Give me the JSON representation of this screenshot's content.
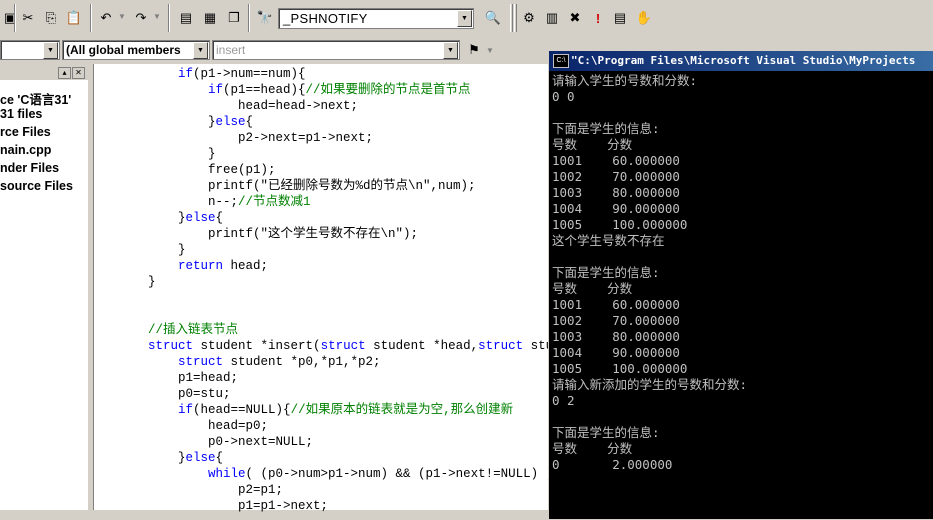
{
  "toolbar1": {
    "class_combo_value": "_PSHNOTIFY"
  },
  "toolbar2": {
    "combo_a": "",
    "combo_members": "(All global members",
    "combo_insert": "insert"
  },
  "workspace": {
    "tree": [
      "ce 'C语言31'",
      "31 files",
      "rce Files",
      "nain.cpp",
      "nder Files",
      "source Files"
    ]
  },
  "editor": {
    "lines": [
      [
        {
          "t": "        ",
          "c": ""
        },
        {
          "t": "if",
          "c": "kw"
        },
        {
          "t": "(p1->num==num){",
          "c": ""
        }
      ],
      [
        {
          "t": "            ",
          "c": ""
        },
        {
          "t": "if",
          "c": "kw"
        },
        {
          "t": "(p1==head){",
          "c": ""
        },
        {
          "t": "//如果要删除的节点是首节点",
          "c": "cm"
        }
      ],
      [
        {
          "t": "                head=head->next;",
          "c": ""
        }
      ],
      [
        {
          "t": "            }",
          "c": ""
        },
        {
          "t": "else",
          "c": "kw"
        },
        {
          "t": "{",
          "c": ""
        }
      ],
      [
        {
          "t": "                p2->next=p1->next;",
          "c": ""
        }
      ],
      [
        {
          "t": "            }",
          "c": ""
        }
      ],
      [
        {
          "t": "            free(p1);",
          "c": ""
        }
      ],
      [
        {
          "t": "            printf(\"已经删除号数为%d的节点\\n\",num);",
          "c": ""
        }
      ],
      [
        {
          "t": "            n--;",
          "c": ""
        },
        {
          "t": "//节点数减1",
          "c": "cm"
        }
      ],
      [
        {
          "t": "        }",
          "c": ""
        },
        {
          "t": "else",
          "c": "kw"
        },
        {
          "t": "{",
          "c": ""
        }
      ],
      [
        {
          "t": "            printf(\"这个学生号数不存在\\n\");",
          "c": ""
        }
      ],
      [
        {
          "t": "        }",
          "c": ""
        }
      ],
      [
        {
          "t": "        ",
          "c": ""
        },
        {
          "t": "return",
          "c": "kw"
        },
        {
          "t": " head;",
          "c": ""
        }
      ],
      [
        {
          "t": "    }",
          "c": ""
        }
      ],
      [
        {
          "t": "",
          "c": ""
        }
      ],
      [
        {
          "t": "",
          "c": ""
        }
      ],
      [
        {
          "t": "    ",
          "c": ""
        },
        {
          "t": "//插入链表节点",
          "c": "cm"
        }
      ],
      [
        {
          "t": "    ",
          "c": ""
        },
        {
          "t": "struct",
          "c": "kw"
        },
        {
          "t": " student *insert(",
          "c": ""
        },
        {
          "t": "struct",
          "c": "kw"
        },
        {
          "t": " student *head,",
          "c": ""
        },
        {
          "t": "struct",
          "c": "kw"
        },
        {
          "t": " stu",
          "c": ""
        }
      ],
      [
        {
          "t": "        ",
          "c": ""
        },
        {
          "t": "struct",
          "c": "kw"
        },
        {
          "t": " student *p0,*p1,*p2;",
          "c": ""
        }
      ],
      [
        {
          "t": "        p1=head;",
          "c": ""
        }
      ],
      [
        {
          "t": "        p0=stu;",
          "c": ""
        }
      ],
      [
        {
          "t": "        ",
          "c": ""
        },
        {
          "t": "if",
          "c": "kw"
        },
        {
          "t": "(head==NULL){",
          "c": ""
        },
        {
          "t": "//如果原本的链表就是为空,那么创建新",
          "c": "cm"
        }
      ],
      [
        {
          "t": "            head=p0;",
          "c": ""
        }
      ],
      [
        {
          "t": "            p0->next=NULL;",
          "c": ""
        }
      ],
      [
        {
          "t": "        }",
          "c": ""
        },
        {
          "t": "else",
          "c": "kw"
        },
        {
          "t": "{",
          "c": ""
        }
      ],
      [
        {
          "t": "            ",
          "c": ""
        },
        {
          "t": "while",
          "c": "kw"
        },
        {
          "t": "( (p0->num>p1->num) && (p1->next!=NULL) )",
          "c": ""
        }
      ],
      [
        {
          "t": "                p2=p1;",
          "c": ""
        }
      ],
      [
        {
          "t": "                p1=p1->next;",
          "c": ""
        }
      ]
    ]
  },
  "console": {
    "title": "\"C:\\Program Files\\Microsoft Visual Studio\\MyProjects",
    "icon_text": "C:\\",
    "lines": [
      "请输入学生的号数和分数:",
      "0 0",
      "",
      "下面是学生的信息:",
      "号数    分数",
      "1001    60.000000",
      "1002    70.000000",
      "1003    80.000000",
      "1004    90.000000",
      "1005    100.000000",
      "这个学生号数不存在",
      "",
      "下面是学生的信息:",
      "号数    分数",
      "1001    60.000000",
      "1002    70.000000",
      "1003    80.000000",
      "1004    90.000000",
      "1005    100.000000",
      "请输入新添加的学生的号数和分数:",
      "0 2",
      "",
      "下面是学生的信息:",
      "号数    分数",
      "0       2.000000"
    ]
  }
}
